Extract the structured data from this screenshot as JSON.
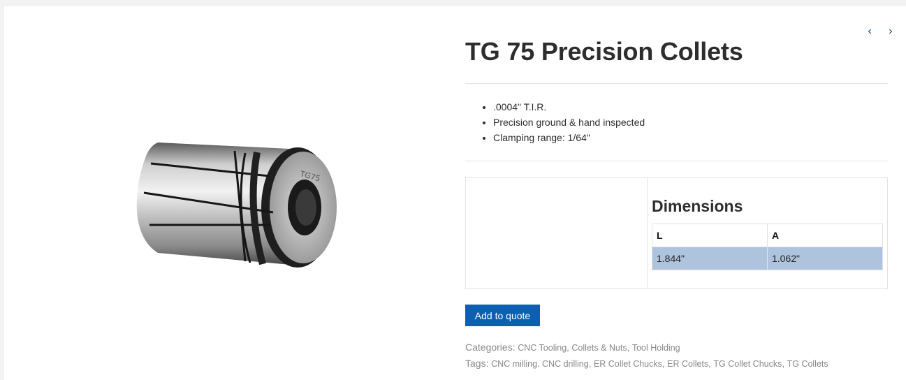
{
  "pager": {
    "prev_icon": "chevron-left-icon",
    "next_icon": "chevron-right-icon",
    "prev_glyph": "‹",
    "next_glyph": "›"
  },
  "product": {
    "title": "TG 75 Precision Collets",
    "image_label": "TG75",
    "features": [
      ".0004\" T.I.R.",
      "Precision ground & hand inspected",
      "Clamping range: 1/64\""
    ],
    "dimensions": {
      "heading": "Dimensions",
      "headers": [
        "L",
        "A"
      ],
      "values": [
        "1.844\"",
        "1.062\""
      ]
    },
    "quote_button": "Add to quote"
  },
  "meta": {
    "categories_label": "Categories:",
    "categories": [
      "CNC Tooling",
      "Collets & Nuts",
      "Tool Holding"
    ],
    "tags_label": "Tags:",
    "tags": [
      "CNC milling. CNC drilling",
      "ER Collet Chucks",
      "ER Collets",
      "TG Collet Chucks",
      "TG Collets"
    ]
  },
  "colors": {
    "accent": "#0c5fb1",
    "table_row": "#aec3de",
    "arrow": "#0b5aa6"
  }
}
